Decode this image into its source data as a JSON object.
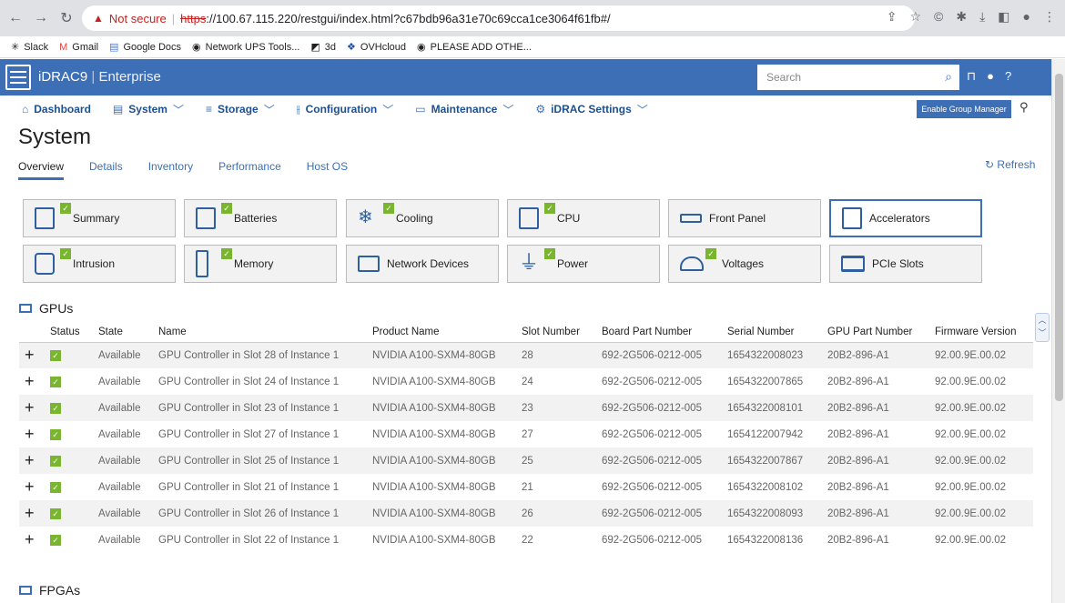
{
  "browser": {
    "not_secure": "Not secure",
    "https": "https",
    "url": "://100.67.115.220/restgui/index.html?c67bdb96a31e70c69cca1ce3064f61fb#/"
  },
  "bookmarks": [
    "Slack",
    "Gmail",
    "Google Docs",
    "Network UPS Tools...",
    "3d",
    "OVHcloud",
    "PLEASE ADD OTHE..."
  ],
  "header": {
    "brand": "iDRAC9",
    "edition": "Enterprise",
    "search_placeholder": "Search"
  },
  "menu": [
    "Dashboard",
    "System",
    "Storage",
    "Configuration",
    "Maintenance",
    "iDRAC Settings"
  ],
  "enable_group_manager": "Enable Group Manager",
  "page_title": "System",
  "tabs": [
    "Overview",
    "Details",
    "Inventory",
    "Performance",
    "Host OS"
  ],
  "refresh": "Refresh",
  "tiles": [
    {
      "label": "Summary",
      "ok": true
    },
    {
      "label": "Batteries",
      "ok": true
    },
    {
      "label": "Cooling",
      "ok": true
    },
    {
      "label": "CPU",
      "ok": true
    },
    {
      "label": "Front Panel",
      "ok": false
    },
    {
      "label": "Accelerators",
      "ok": false
    },
    {
      "label": "Intrusion",
      "ok": true
    },
    {
      "label": "Memory",
      "ok": true
    },
    {
      "label": "Network Devices",
      "ok": false
    },
    {
      "label": "Power",
      "ok": true
    },
    {
      "label": "Voltages",
      "ok": true
    },
    {
      "label": "PCIe Slots",
      "ok": false
    }
  ],
  "gpus": {
    "title": "GPUs",
    "columns": [
      "Status",
      "State",
      "Name",
      "Product Name",
      "Slot Number",
      "Board Part Number",
      "Serial Number",
      "GPU Part Number",
      "Firmware Version"
    ],
    "rows": [
      [
        "Available",
        "GPU Controller in Slot 28 of Instance 1",
        "NVIDIA A100-SXM4-80GB",
        "28",
        "692-2G506-0212-005",
        "1654322008023",
        "20B2-896-A1",
        "92.00.9E.00.02"
      ],
      [
        "Available",
        "GPU Controller in Slot 24 of Instance 1",
        "NVIDIA A100-SXM4-80GB",
        "24",
        "692-2G506-0212-005",
        "1654322007865",
        "20B2-896-A1",
        "92.00.9E.00.02"
      ],
      [
        "Available",
        "GPU Controller in Slot 23 of Instance 1",
        "NVIDIA A100-SXM4-80GB",
        "23",
        "692-2G506-0212-005",
        "1654322008101",
        "20B2-896-A1",
        "92.00.9E.00.02"
      ],
      [
        "Available",
        "GPU Controller in Slot 27 of Instance 1",
        "NVIDIA A100-SXM4-80GB",
        "27",
        "692-2G506-0212-005",
        "1654122007942",
        "20B2-896-A1",
        "92.00.9E.00.02"
      ],
      [
        "Available",
        "GPU Controller in Slot 25 of Instance 1",
        "NVIDIA A100-SXM4-80GB",
        "25",
        "692-2G506-0212-005",
        "1654322007867",
        "20B2-896-A1",
        "92.00.9E.00.02"
      ],
      [
        "Available",
        "GPU Controller in Slot 21 of Instance 1",
        "NVIDIA A100-SXM4-80GB",
        "21",
        "692-2G506-0212-005",
        "1654322008102",
        "20B2-896-A1",
        "92.00.9E.00.02"
      ],
      [
        "Available",
        "GPU Controller in Slot 26 of Instance 1",
        "NVIDIA A100-SXM4-80GB",
        "26",
        "692-2G506-0212-005",
        "1654322008093",
        "20B2-896-A1",
        "92.00.9E.00.02"
      ],
      [
        "Available",
        "GPU Controller in Slot 22 of Instance 1",
        "NVIDIA A100-SXM4-80GB",
        "22",
        "692-2G506-0212-005",
        "1654322008136",
        "20B2-896-A1",
        "92.00.9E.00.02"
      ]
    ]
  },
  "fpgas": {
    "title": "FPGAs"
  }
}
